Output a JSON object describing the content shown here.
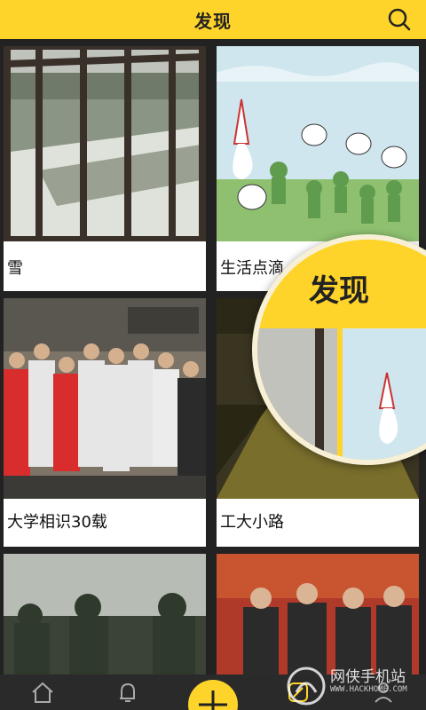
{
  "header": {
    "title": "发现",
    "search_icon": "search-icon"
  },
  "cards": [
    {
      "label": "雪"
    },
    {
      "label": "生活点滴"
    },
    {
      "label": "大学相识30载"
    },
    {
      "label": "工大小路"
    },
    {
      "label": ""
    },
    {
      "label": ""
    }
  ],
  "magnifier": {
    "title": "发现"
  },
  "bottom_nav": {
    "items": [
      "home-icon",
      "bell-icon",
      "discover-icon",
      "edit-icon",
      "profile-icon"
    ]
  },
  "watermark": {
    "brand": "网侠手机站",
    "url": "WWW.HACKHOME.COM"
  },
  "colors": {
    "accent": "#ffd42a",
    "nav_bg": "#2a2a2a"
  }
}
